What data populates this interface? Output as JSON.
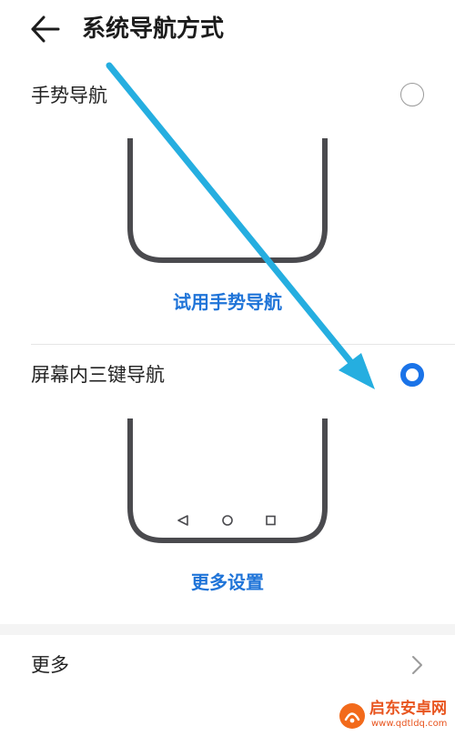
{
  "header": {
    "title": "系统导航方式",
    "back_icon": "arrow-left-icon"
  },
  "options": [
    {
      "label": "手势导航",
      "selected": false,
      "link_text": "试用手势导航"
    },
    {
      "label": "屏幕内三键导航",
      "selected": true,
      "link_text": "更多设置",
      "nav_icons": [
        "triangle-back-icon",
        "circle-home-icon",
        "square-recent-icon"
      ]
    }
  ],
  "more": {
    "label": "更多",
    "chevron_icon": "chevron-right-icon"
  },
  "watermark": {
    "name": "启东安卓网",
    "url": "www.qdtldq.com"
  },
  "colors": {
    "accent": "#1a73e8",
    "link": "#1f74d8",
    "annotation_arrow": "#25aee0",
    "phone_frame": "#4a4a4e"
  }
}
